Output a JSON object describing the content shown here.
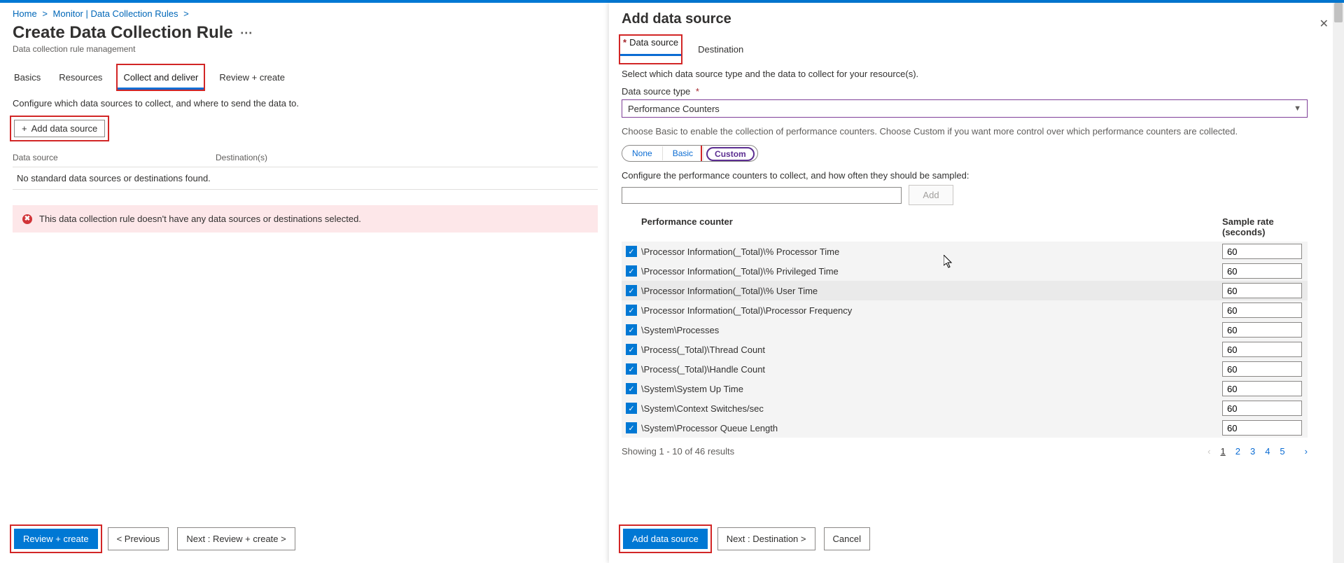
{
  "breadcrumb": {
    "home": "Home",
    "monitor": "Monitor | Data Collection Rules"
  },
  "page": {
    "title": "Create Data Collection Rule",
    "subtitle": "Data collection rule management",
    "configure_text": "Configure which data sources to collect, and where to send the data to.",
    "add_data_source": "Add data source",
    "col_data_source": "Data source",
    "col_destinations": "Destination(s)",
    "empty_msg": "No standard data sources or destinations found.",
    "alert_msg": "This data collection rule doesn't have any data sources or destinations selected."
  },
  "tabs": {
    "basics": "Basics",
    "resources": "Resources",
    "collect": "Collect and deliver",
    "review": "Review + create"
  },
  "buttons": {
    "review_create": "Review + create",
    "previous": "< Previous",
    "next_main": "Next : Review + create >"
  },
  "blade": {
    "title": "Add data source",
    "tab_data_source": "Data source",
    "tab_destination": "Destination",
    "intro": "Select which data source type and the data to collect for your resource(s).",
    "ds_type_label": "Data source type",
    "ds_type_value": "Performance Counters",
    "help": "Choose Basic to enable the collection of performance counters. Choose Custom if you want more control over which performance counters are collected.",
    "pill_none": "None",
    "pill_basic": "Basic",
    "pill_custom": "Custom",
    "config_text": "Configure the performance counters to collect, and how often they should be sampled:",
    "add_btn": "Add",
    "th_counter": "Performance counter",
    "th_rate": "Sample rate (seconds)",
    "results": "Showing 1 - 10 of 46 results",
    "btn_add": "Add data source",
    "btn_next": "Next : Destination >",
    "btn_cancel": "Cancel"
  },
  "counters": [
    {
      "name": "\\Processor Information(_Total)\\% Processor Time",
      "rate": "60"
    },
    {
      "name": "\\Processor Information(_Total)\\% Privileged Time",
      "rate": "60"
    },
    {
      "name": "\\Processor Information(_Total)\\% User Time",
      "rate": "60"
    },
    {
      "name": "\\Processor Information(_Total)\\Processor Frequency",
      "rate": "60"
    },
    {
      "name": "\\System\\Processes",
      "rate": "60"
    },
    {
      "name": "\\Process(_Total)\\Thread Count",
      "rate": "60"
    },
    {
      "name": "\\Process(_Total)\\Handle Count",
      "rate": "60"
    },
    {
      "name": "\\System\\System Up Time",
      "rate": "60"
    },
    {
      "name": "\\System\\Context Switches/sec",
      "rate": "60"
    },
    {
      "name": "\\System\\Processor Queue Length",
      "rate": "60"
    }
  ],
  "pages": [
    "1",
    "2",
    "3",
    "4",
    "5"
  ]
}
